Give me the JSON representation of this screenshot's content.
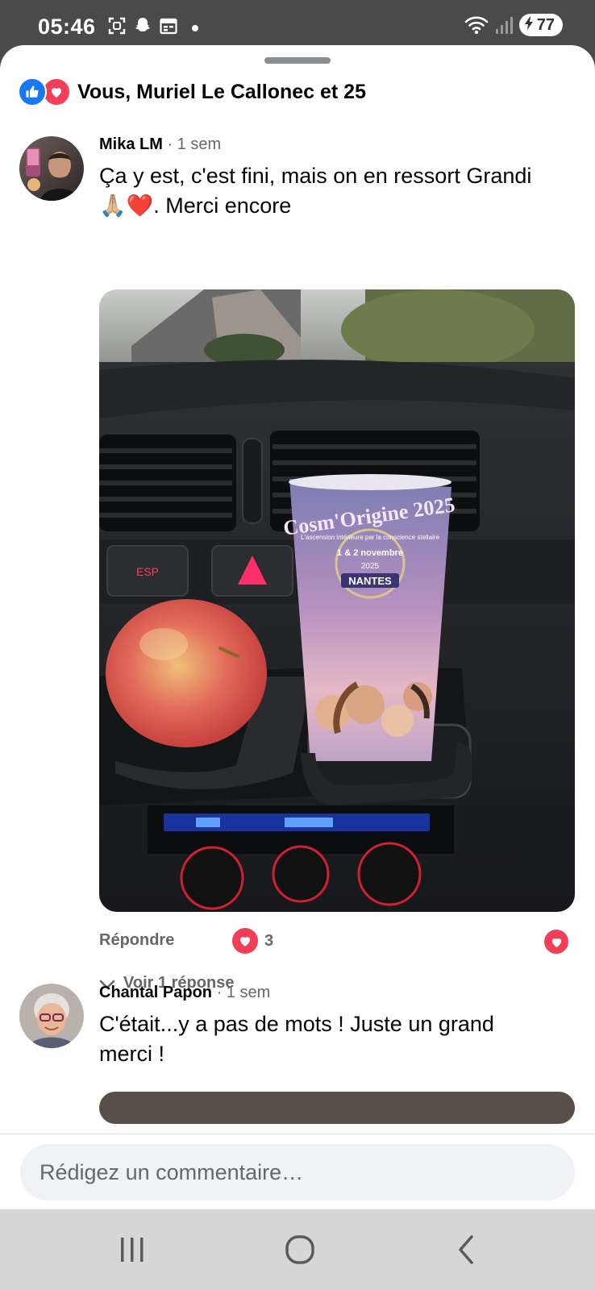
{
  "status_bar": {
    "time": "05:46",
    "battery": "77"
  },
  "reactions_summary": {
    "text": "Vous, Muriel Le Callonec et 25"
  },
  "comments": [
    {
      "author": "Mika LM",
      "time": "· 1 sem",
      "text_line1": "Ça y est, c'est fini, mais on en ressort Grandi",
      "text_line2_emoji": "🙏🏼❤️",
      "text_line2": ". Merci encore",
      "reply_label": "Répondre",
      "love_count": "3",
      "view_replies": "Voir 1 réponse",
      "photo": {
        "cup_brand": "Cosm'Origine 2025",
        "cup_tagline": "L'ascension intérieure par la conscience stellaire",
        "cup_date": "1 & 2 novembre",
        "cup_year": "2025",
        "cup_city": "NANTES",
        "esp_label": "ESP"
      }
    },
    {
      "author": "Chantal Papon",
      "time": "· 1 sem",
      "text_line1": "C'était...y a pas de mots ! Juste un grand",
      "text_line2": "merci !"
    }
  ],
  "composer": {
    "placeholder": "Rédigez un commentaire…"
  },
  "colors": {
    "like_blue": "#1877f2",
    "love_red": "#f33e58",
    "muted": "#65676b"
  }
}
